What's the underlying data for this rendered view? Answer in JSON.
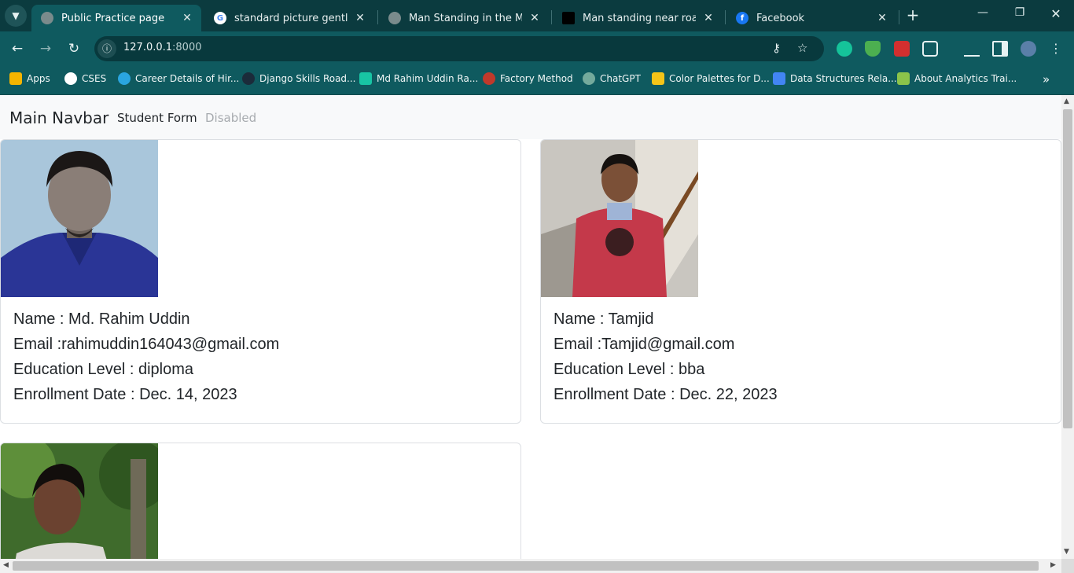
{
  "browser": {
    "tabs": [
      {
        "title": "Public Practice page",
        "active": true,
        "icon": "globe-icon"
      },
      {
        "title": "standard picture gentle size",
        "active": false,
        "icon": "google-icon"
      },
      {
        "title": "Man Standing in the Middle",
        "active": false,
        "icon": "globe-icon"
      },
      {
        "title": "Man standing near road nex",
        "active": false,
        "icon": "unsplash-icon"
      },
      {
        "title": "Facebook",
        "active": false,
        "icon": "facebook-icon"
      }
    ],
    "address": {
      "host": "127.0.0.1",
      "port": ":8000"
    },
    "bookmarks": [
      {
        "label": "Apps",
        "icon": "apps-grid-icon",
        "color": "#f4b400"
      },
      {
        "label": "CSES",
        "icon": "globe-icon",
        "color": "#ffffff"
      },
      {
        "label": "Career Details of Hir...",
        "icon": "career-icon",
        "color": "#2aa5e0"
      },
      {
        "label": "Django Skills Road...",
        "icon": "django-icon",
        "color": "#1b2b3a"
      },
      {
        "label": "Md Rahim Uddin Ra...",
        "icon": "profile-icon",
        "color": "#18c4a4"
      },
      {
        "label": "Factory Method",
        "icon": "raccoon-icon",
        "color": "#c0392b"
      },
      {
        "label": "ChatGPT",
        "icon": "chatgpt-icon",
        "color": "#74aa9c"
      },
      {
        "label": "Color Palettes for D...",
        "icon": "palette-icon",
        "color": "#f5c518"
      },
      {
        "label": "Data Structures Rela...",
        "icon": "docs-icon",
        "color": "#4285f4"
      },
      {
        "label": "About Analytics Trai...",
        "icon": "analytics-icon",
        "color": "#8bc34a"
      }
    ]
  },
  "navbar": {
    "brand": "Main Navbar",
    "links": [
      {
        "label": "Student Form",
        "disabled": false
      },
      {
        "label": "Disabled",
        "disabled": true
      }
    ]
  },
  "students": [
    {
      "name": "Name : Md. Rahim Uddin",
      "email": "Email :rahimuddin164043@gmail.com",
      "education": "Education Level : diploma",
      "enrollment": "Enrollment Date : Dec. 14, 2023"
    },
    {
      "name": "Name : Tamjid",
      "email": "Email :Tamjid@gmail.com",
      "education": "Education Level : bba",
      "enrollment": "Enrollment Date : Dec. 22, 2023"
    },
    {
      "name": "",
      "email": "",
      "education": "",
      "enrollment": ""
    }
  ],
  "colors": {
    "browser_frame": "#0b3b3f",
    "toolbar": "#0f5a5f",
    "navbar_bg": "#f8f9fa"
  }
}
